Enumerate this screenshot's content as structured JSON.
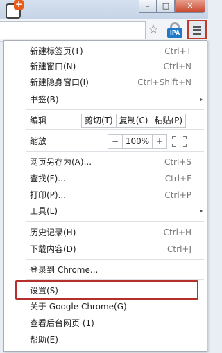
{
  "window": {
    "minimize": "–",
    "maximize": "□",
    "close": "✕"
  },
  "toolbar": {
    "star_icon": "star-icon",
    "ipa_label": "IPA",
    "menu_icon": "hamburger-icon"
  },
  "menu": {
    "new_tab": {
      "label": "新建标签页(T)",
      "shortcut": "Ctrl+T"
    },
    "new_window": {
      "label": "新建窗口(N)",
      "shortcut": "Ctrl+N"
    },
    "new_incognito": {
      "label": "新建隐身窗口(I)",
      "shortcut": "Ctrl+Shift+N"
    },
    "bookmarks": {
      "label": "书签(B)"
    },
    "edit": {
      "label": "编辑",
      "cut": "剪切(T)",
      "copy": "复制(C)",
      "paste": "粘贴(P)"
    },
    "zoom": {
      "label": "缩放",
      "minus": "−",
      "value": "100%",
      "plus": "+"
    },
    "save_as": {
      "label": "网页另存为(A)...",
      "shortcut": "Ctrl+S"
    },
    "find": {
      "label": "查找(F)...",
      "shortcut": "Ctrl+F"
    },
    "print": {
      "label": "打印(P)...",
      "shortcut": "Ctrl+P"
    },
    "tools": {
      "label": "工具(L)"
    },
    "history": {
      "label": "历史记录(H)",
      "shortcut": "Ctrl+H"
    },
    "downloads": {
      "label": "下载内容(D)",
      "shortcut": "Ctrl+J"
    },
    "sign_in": {
      "label": "登录到 Chrome..."
    },
    "settings": {
      "label": "设置(S)"
    },
    "about": {
      "label": "关于 Google Chrome(G)"
    },
    "background_pages": {
      "label": "查看后台网页 (1)"
    },
    "help": {
      "label": "帮助(E)"
    }
  },
  "colors": {
    "highlight": "#b5302b",
    "close_button": "#c8452a",
    "ipa_badge": "#1f79c8"
  }
}
